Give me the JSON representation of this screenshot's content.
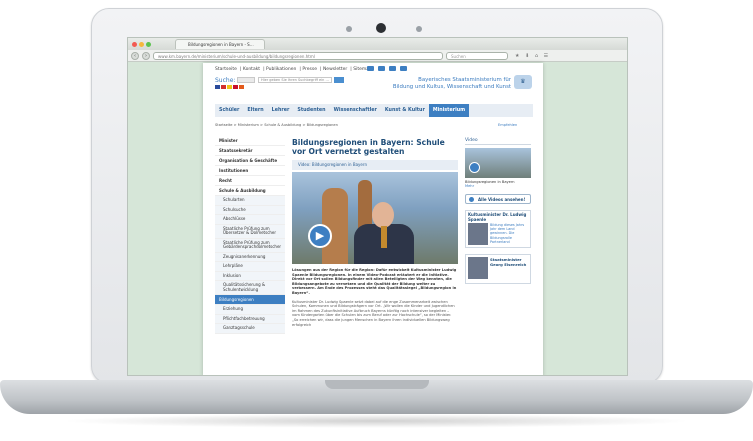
{
  "browser": {
    "tab_title": "Bildungsregionen in Bayern - S…",
    "url": "www.km.bayern.de/ministerium/schule-und-ausbildung/bildungsregionen.html",
    "search_placeholder": "Suchen"
  },
  "site": {
    "meta_links": [
      "Startseite",
      "Kontakt",
      "Publikationen",
      "Presse",
      "Newsletter",
      "Sitemap"
    ],
    "search_label": "Suche:",
    "search_placeholder": "Hier geben Sie Ihren Suchbegriff ein …",
    "ministry_line1": "Bayerisches Staatsministerium für",
    "ministry_line2": "Bildung und Kultus, Wissenschaft und Kunst",
    "nav_tabs": [
      "Schüler",
      "Eltern",
      "Lehrer",
      "Studenten",
      "Wissenschaftler",
      "Kunst & Kultur",
      "Ministerium"
    ],
    "breadcrumb": "Startseite  >  Ministerium  >  Schule & Ausbildung  >  Bildungsregionen",
    "recommend": "Empfehlen"
  },
  "sidebar": [
    {
      "label": "Minister",
      "type": "bold"
    },
    {
      "label": "Staatssekretär",
      "type": "bold"
    },
    {
      "label": "Organisation & Geschäfte",
      "type": "bold"
    },
    {
      "label": "Institutionen",
      "type": "bold"
    },
    {
      "label": "Recht",
      "type": "bold"
    },
    {
      "label": "Schule & Ausbildung",
      "type": "bold"
    },
    {
      "label": "Schularten",
      "type": "sub"
    },
    {
      "label": "Schulsuche",
      "type": "sub"
    },
    {
      "label": "Abschlüsse",
      "type": "sub"
    },
    {
      "label": "Staatliche Prüfung zum Übersetzer & Dolmetscher",
      "type": "sub"
    },
    {
      "label": "Staatliche Prüfung zum Gebärdensprachdolmetscher",
      "type": "sub"
    },
    {
      "label": "Zeugnisanerkennung",
      "type": "sub"
    },
    {
      "label": "Lehrpläne",
      "type": "sub"
    },
    {
      "label": "Inklusion",
      "type": "sub"
    },
    {
      "label": "Qualitätssicherung & Schulentwicklung",
      "type": "sub"
    },
    {
      "label": "Bildungsregionen",
      "type": "active"
    },
    {
      "label": "Erziehung",
      "type": "sub"
    },
    {
      "label": "Pflichtfachbetreuung",
      "type": "sub"
    },
    {
      "label": "Ganztagsschule",
      "type": "sub"
    }
  ],
  "article": {
    "title": "Bildungsregionen in Bayern: Schule vor Ort vernetzt gestalten",
    "video_label": "Video: Bildungsregionen in Bayern",
    "lead": "Lösungen aus der Region für die Region: Dafür entwickelt Kultusminister Ludwig Spaenle Bildungsregionen. In einem Video-Podcast erläutert er die Initiative. Direkt vor Ort sollen Bildungsfinder mit allen Beteiligten der Weg kennten, die Bildungsangebote zu vernetzen und die Qualität der Bildung weiter zu verbessern. Am Ende des Prozesses steht das Qualitätssiegel „Bildungsregion in Bayern“.",
    "body": "Kultusminister Dr. Ludwig Spaenle setzt dabei auf die enge Zusammenarbeit zwischen Schulen, Kommunen und Bildungsträgern vor Ort. „Wir wollen die Kinder und Jugendlichen im Rahmen des Zukunftsinitiative Aufbruch Bayerns künftig noch intensiver begleiten – vom Kindergarten über die Schulen bis zum Beruf oder zur Hochschule“, so der Minister. „So erreichen wir, dass die jungen Menschen in Bayern ihren individuellen Bildungsweg erfolgreich"
  },
  "right": {
    "video_heading": "Video",
    "video_caption": "Bildungsregionen in Bayern",
    "video_link": "Mehr",
    "all_videos": "Alle Videos ansehen!",
    "minister_title": "Kultusminister Dr. Ludwig Spaenle",
    "minister_links": "Bildung dieses Jahrs Jahr dem Land gewinnen. Die Bildungsrolle Partnerland",
    "box_title": "Staatsminister Georg Eisenreich"
  },
  "colors": {
    "accent": "#3d7fc2",
    "title": "#1f4d78",
    "nav_bg": "#e7edf4"
  }
}
